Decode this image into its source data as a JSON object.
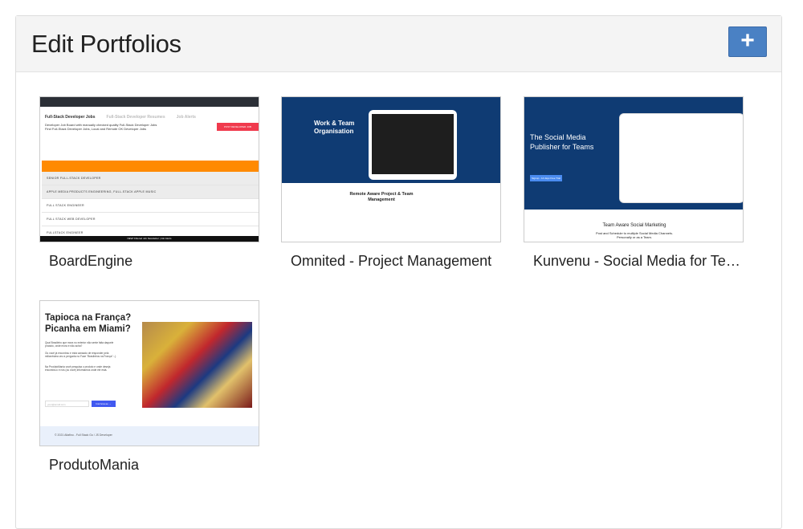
{
  "header": {
    "title": "Edit Portfolios",
    "add_button": "+"
  },
  "portfolios": [
    {
      "name": "BoardEngine",
      "preview": {
        "tabs": [
          "Full-Stack Developer Jobs",
          "Full-Stack Developer Resumes",
          "Job Alerts"
        ],
        "desc": "Developer Job Board with manually checked quality Full-Stack Developer Jobs",
        "desc2": "Find Full-Stack Developer Jobs, Local and Remote OK Developer Jobs",
        "post_button": "POST DEVELOPER JOB",
        "rows": [
          "SENIOR FULL-STACK DEVELOPER",
          "APPLE MEDIA PRODUCTS ENGINEERING, FULL-STACK APPLE MUSIC",
          "FULL STACK ENGINEER",
          "FULL STACK WEB DEVELOPER",
          "FULLSTACK ENGINEER"
        ],
        "footer": "NEW! Filtered Job Newsletter | Job Alerts"
      }
    },
    {
      "name": "Omnited - Project Management",
      "preview": {
        "headline": "Work & Team Organisation",
        "section": "Remote Aware Project & Team Management"
      }
    },
    {
      "name": "Kunvenu - Social Media for Teams",
      "preview": {
        "headline": "The Social Media Publisher for Teams",
        "button": "Signup - 14 days Free Trial",
        "section": "Team Aware Social Marketing",
        "sub": "Post and Schedule to multiple Social Media Channels. Personally or as a Team."
      }
    },
    {
      "name": "ProdutoMania",
      "preview": {
        "headline": "Tapioca na França? Picanha em Miami?",
        "p1": "Qual Brasileiro que mora no exterior não sente falta daquele produto, onde mora e não acha?",
        "p2": "Ou você já encontrou e está cansado de responder pela milionésima vez a pergunta no Face \"Brasileiros na França\" :-)",
        "p3": "Na ProdutoMania você pesquisa o produto e onde deseja encontrá-lo e nós (ou você) informamos onde ele está.",
        "email_placeholder": "your@email.com",
        "subscribe": "Inscreva-se →",
        "footer": "© 2021 Altafino - Full Stack Go / JS Developer"
      }
    }
  ]
}
